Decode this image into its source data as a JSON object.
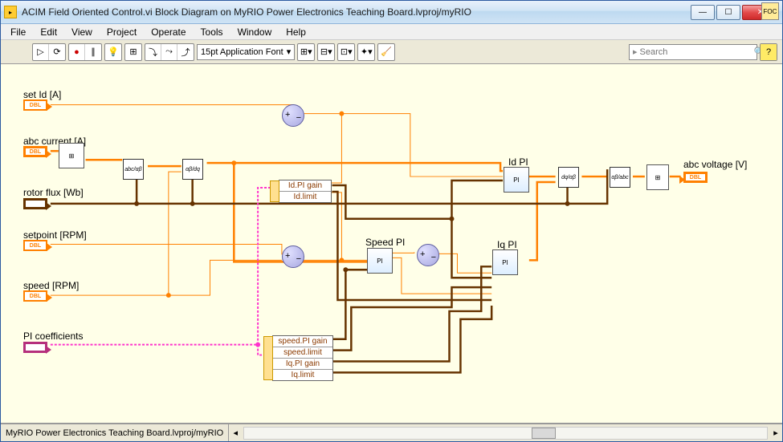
{
  "window": {
    "title": "ACIM Field Oriented Control.vi Block Diagram on MyRIO Power Electronics Teaching Board.lvproj/myRIO"
  },
  "menu": {
    "file": "File",
    "edit": "Edit",
    "view": "View",
    "project": "Project",
    "operate": "Operate",
    "tools": "Tools",
    "window": "Window",
    "help": "Help"
  },
  "toolbar": {
    "font": "15pt Application Font",
    "search_placeholder": "Search"
  },
  "labels": {
    "set_id": "set Id [A]",
    "abc_current": "abc current [A]",
    "rotor_flux": "rotor flux [Wb]",
    "setpoint": "setpoint [RPM]",
    "speed": "speed [RPM]",
    "pi_coeffs": "PI coefficients",
    "id_pi": "Id PI",
    "iq_pi": "Iq PI",
    "speed_pi": "Speed PI",
    "abc_voltage": "abc voltage [V]"
  },
  "unbundle_id": {
    "r1": "Id.PI gain",
    "r2": "Id.limit"
  },
  "unbundle_speed": {
    "r1": "speed.PI gain",
    "r2": "speed.limit",
    "r3": "Iq.PI gain",
    "r4": "Iq.limit"
  },
  "status": {
    "path": "MyRIO Power Electronics Teaching Board.lvproj/myRIO"
  },
  "dbl_text": "DBL"
}
